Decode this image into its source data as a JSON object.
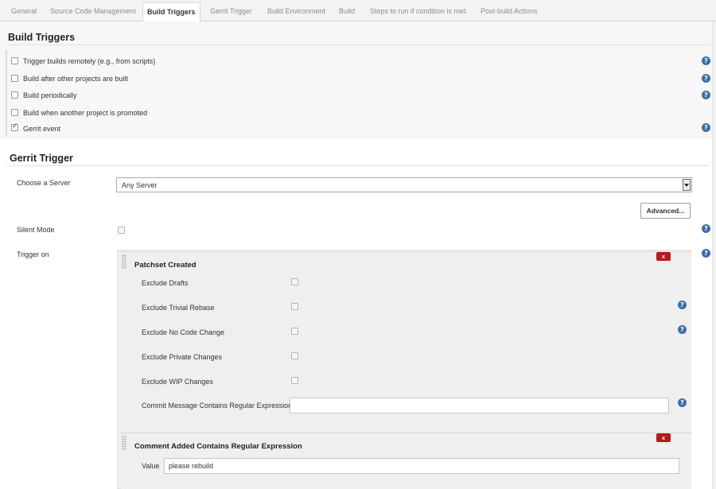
{
  "tabs": [
    {
      "label": "General",
      "active": false
    },
    {
      "label": "Source Code Management",
      "active": false
    },
    {
      "label": "Build Triggers",
      "active": true
    },
    {
      "label": "Gerrit Trigger",
      "active": false
    },
    {
      "label": "Build Environment",
      "active": false
    },
    {
      "label": "Build",
      "active": false
    },
    {
      "label": "Steps to run if condition is met",
      "active": false
    },
    {
      "label": "Post-build Actions",
      "active": false
    }
  ],
  "build_triggers": {
    "title": "Build Triggers",
    "options": [
      {
        "label": "Trigger builds remotely (e.g., from scripts)",
        "checked": false,
        "help": true
      },
      {
        "label": "Build after other projects are built",
        "checked": false,
        "help": true
      },
      {
        "label": "Build periodically",
        "checked": false,
        "help": true
      },
      {
        "label": "Build when another project is promoted",
        "checked": false,
        "help": false
      },
      {
        "label": "Gerrit event",
        "checked": true,
        "help": true
      }
    ]
  },
  "gerrit_trigger": {
    "title": "Gerrit Trigger",
    "choose_server_label": "Choose a Server",
    "server_selected": "Any Server",
    "advanced_button": "Advanced...",
    "silent_mode_label": "Silent Mode",
    "silent_mode_checked": false,
    "trigger_on_label": "Trigger on"
  },
  "patchset_created": {
    "title": "Patchset Created",
    "remove_label": "x",
    "options": [
      {
        "label": "Exclude Drafts",
        "checked": false,
        "help": false
      },
      {
        "label": "Exclude Trivial Rebase",
        "checked": false,
        "help": true
      },
      {
        "label": "Exclude No Code Change",
        "checked": false,
        "help": true
      },
      {
        "label": "Exclude Private Changes",
        "checked": false,
        "help": false
      },
      {
        "label": "Exclude WIP Changes",
        "checked": false,
        "help": false
      }
    ],
    "commit_message_label": "Commit Message Contains Regular Expression",
    "commit_message_value": ""
  },
  "comment_added": {
    "title": "Comment Added Contains Regular Expression",
    "remove_label": "x",
    "value_label": "Value",
    "value": "please rebuild"
  },
  "help_glyph": "?",
  "colors": {
    "help_icon": "#3d6ea8",
    "remove_button": "#b21c1c",
    "section_background": "#f7f7f7",
    "panel_background": "#efefef"
  }
}
